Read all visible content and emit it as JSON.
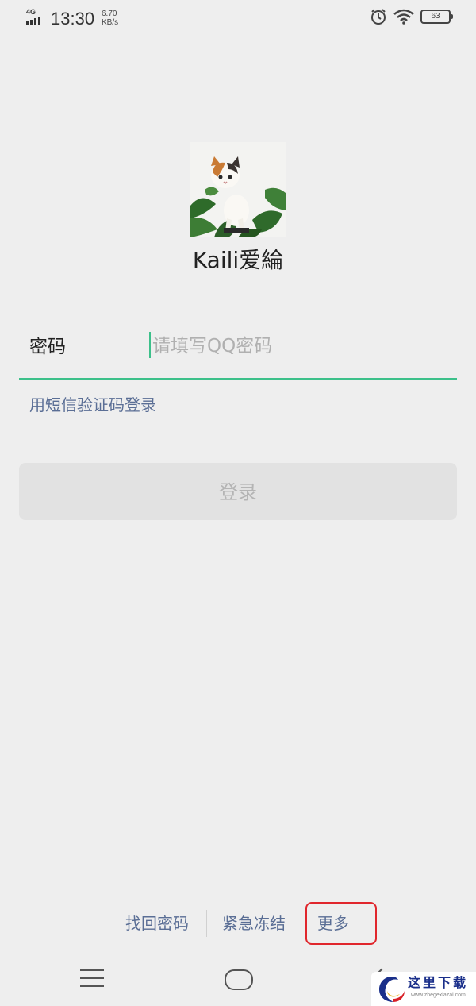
{
  "status_bar": {
    "network": "4G",
    "time": "13:30",
    "net_speed_value": "6.70",
    "net_speed_unit": "KB/s",
    "battery": "63"
  },
  "profile": {
    "username": "Kaili爱綸"
  },
  "form": {
    "password_label": "密码",
    "password_placeholder": "请填写QQ密码",
    "password_value": "",
    "sms_login": "用短信验证码登录",
    "login_button": "登录"
  },
  "bottom_links": {
    "find_password": "找回密码",
    "emergency_freeze": "紧急冻结",
    "more": "更多"
  },
  "watermark": {
    "text": "这里下载",
    "url": "www.zhegexiazai.com"
  },
  "colors": {
    "background": "#eeeeee",
    "accent_green": "#3cc08a",
    "link_blue": "#5a6e95",
    "highlight_red": "#e0262c"
  }
}
